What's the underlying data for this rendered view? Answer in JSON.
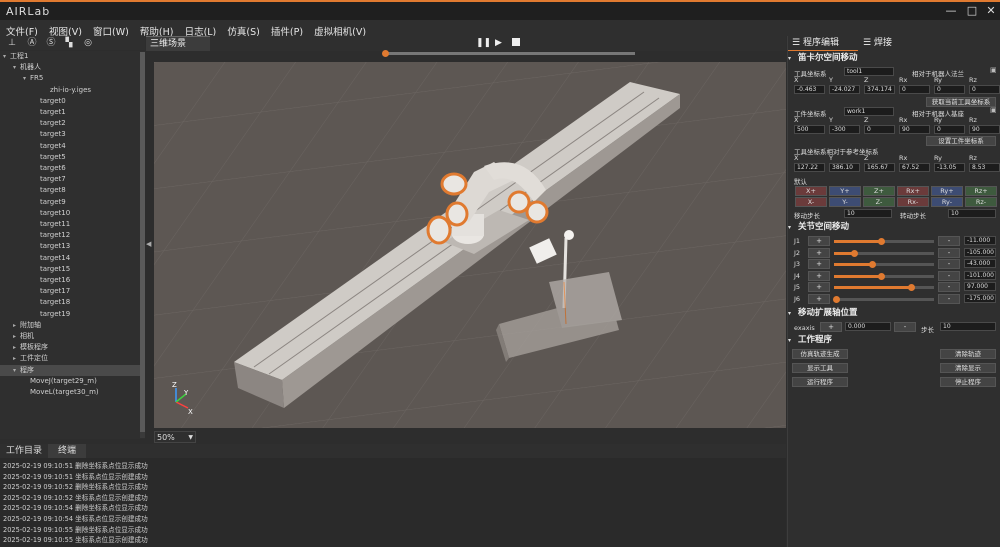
{
  "app": {
    "logo": "AIRLab",
    "min": "—",
    "max": "□",
    "close": "✕"
  },
  "menu": [
    "文件(F)",
    "视图(V)",
    "窗口(W)",
    "帮助(H)",
    "日志(L)",
    "仿真(S)",
    "插件(P)",
    "虚拟相机(V)"
  ],
  "toolbar_icons": [
    "axis-icon",
    "a-icon",
    "s-icon",
    "grid-icon",
    "target-icon"
  ],
  "tree": [
    {
      "label": "工程1",
      "indent": 0,
      "arrow": "▾"
    },
    {
      "label": "机器人",
      "indent": 1,
      "arrow": "▾"
    },
    {
      "label": "FR5",
      "indent": 2,
      "arrow": "▾"
    },
    {
      "label": "zhi-io-y.iges",
      "indent": 4,
      "arrow": ""
    },
    {
      "label": "target0",
      "indent": 3,
      "arrow": ""
    },
    {
      "label": "target1",
      "indent": 3,
      "arrow": ""
    },
    {
      "label": "target2",
      "indent": 3,
      "arrow": ""
    },
    {
      "label": "target3",
      "indent": 3,
      "arrow": ""
    },
    {
      "label": "target4",
      "indent": 3,
      "arrow": ""
    },
    {
      "label": "target5",
      "indent": 3,
      "arrow": ""
    },
    {
      "label": "target6",
      "indent": 3,
      "arrow": ""
    },
    {
      "label": "target7",
      "indent": 3,
      "arrow": ""
    },
    {
      "label": "target8",
      "indent": 3,
      "arrow": ""
    },
    {
      "label": "target9",
      "indent": 3,
      "arrow": ""
    },
    {
      "label": "target10",
      "indent": 3,
      "arrow": ""
    },
    {
      "label": "target11",
      "indent": 3,
      "arrow": ""
    },
    {
      "label": "target12",
      "indent": 3,
      "arrow": ""
    },
    {
      "label": "target13",
      "indent": 3,
      "arrow": ""
    },
    {
      "label": "target14",
      "indent": 3,
      "arrow": ""
    },
    {
      "label": "target15",
      "indent": 3,
      "arrow": ""
    },
    {
      "label": "target16",
      "indent": 3,
      "arrow": ""
    },
    {
      "label": "target17",
      "indent": 3,
      "arrow": ""
    },
    {
      "label": "target18",
      "indent": 3,
      "arrow": ""
    },
    {
      "label": "target19",
      "indent": 3,
      "arrow": ""
    },
    {
      "label": "附加轴",
      "indent": 1,
      "arrow": "▸"
    },
    {
      "label": "相机",
      "indent": 1,
      "arrow": "▸"
    },
    {
      "label": "模板程序",
      "indent": 1,
      "arrow": "▸"
    },
    {
      "label": "工件定位",
      "indent": 1,
      "arrow": "▸"
    },
    {
      "label": "程序",
      "indent": 1,
      "arrow": "▾",
      "selected": true
    },
    {
      "label": "MoveJ(target29_m)",
      "indent": 2,
      "arrow": ""
    },
    {
      "label": "MoveL(target30_m)",
      "indent": 2,
      "arrow": ""
    }
  ],
  "viewport": {
    "tab": "三维场景",
    "zoom": "50%",
    "play_icons": [
      "pause-icon",
      "play-icon",
      "stop-icon"
    ]
  },
  "bottom": {
    "tabs": [
      "工作目录",
      "终端"
    ],
    "log": [
      "2025-02-19 09:10:51 删除坐标系点位显示成功",
      "2025-02-19 09:10:51 坐标系点位显示创建成功",
      "2025-02-19 09:10:52 删除坐标系点位显示成功",
      "2025-02-19 09:10:52 坐标系点位显示创建成功",
      "2025-02-19 09:10:54 删除坐标系点位显示成功",
      "2025-02-19 09:10:54 坐标系点位显示创建成功",
      "2025-02-19 09:10:55 删除坐标系点位显示成功",
      "2025-02-19 09:10:55 坐标系点位显示创建成功"
    ]
  },
  "right": {
    "tabs": [
      "程序编辑",
      "焊接"
    ],
    "cartesian": {
      "title": "笛卡尔空间移动",
      "tool_label": "工具坐标系",
      "tool_value": "tool1",
      "tool_rel": "相对于机器人法兰",
      "axes": [
        "X",
        "Y",
        "Z",
        "Rx",
        "Ry",
        "Rz"
      ],
      "tool_vals": [
        "-0.463",
        "-24.027",
        "374.174",
        "0",
        "0",
        "0"
      ],
      "get_tool_btn": "获取当前工具坐标系",
      "work_label": "工件坐标系",
      "work_value": "work1",
      "work_rel": "相对于机器人基座",
      "work_vals": [
        "500",
        "-300",
        "0",
        "90",
        "0",
        "90"
      ],
      "set_work_btn": "设置工件坐标系",
      "rel_label": "工具坐标系相对于参考坐标系",
      "rel_vals": [
        "127.22",
        "386.10",
        "165.67",
        "67.52",
        "-13.05",
        "8.53"
      ],
      "default_label": "默认",
      "jog_row1": [
        "X+",
        "Y+",
        "Z+",
        "Rx+",
        "Ry+",
        "Rz+"
      ],
      "jog_row2": [
        "X-",
        "Y-",
        "Z-",
        "Rx-",
        "Ry-",
        "Rz-"
      ],
      "move_step_label": "移动步长",
      "move_step": "10",
      "rot_step_label": "转动步长",
      "rot_step": "10"
    },
    "joint": {
      "title": "关节空间移动",
      "joints": [
        {
          "name": "J1",
          "value": "-11.000",
          "level": 0.47
        },
        {
          "name": "J2",
          "value": "-105.000",
          "level": 0.2
        },
        {
          "name": "J3",
          "value": "-43.000",
          "level": 0.38
        },
        {
          "name": "J4",
          "value": "-101.000",
          "level": 0.47
        },
        {
          "name": "J5",
          "value": "97.000",
          "level": 0.77
        },
        {
          "name": "J6",
          "value": "-175.000",
          "level": 0.02
        }
      ],
      "plus": "+",
      "minus": "-"
    },
    "extaxis": {
      "title": "移动扩展轴位置",
      "label": "exaxis",
      "value": "0.000",
      "step_label": "步长",
      "step": "10",
      "plus": "+",
      "minus": "-"
    },
    "program": {
      "title": "工作程序",
      "left_btns": [
        "仿真轨迹生成",
        "显示工具",
        "运行程序"
      ],
      "right_btns": [
        "清除轨迹",
        "清除显示",
        "停止程序"
      ]
    }
  },
  "colors": {
    "accent": "#e07a30",
    "viewport_bg": "#5d5753"
  }
}
